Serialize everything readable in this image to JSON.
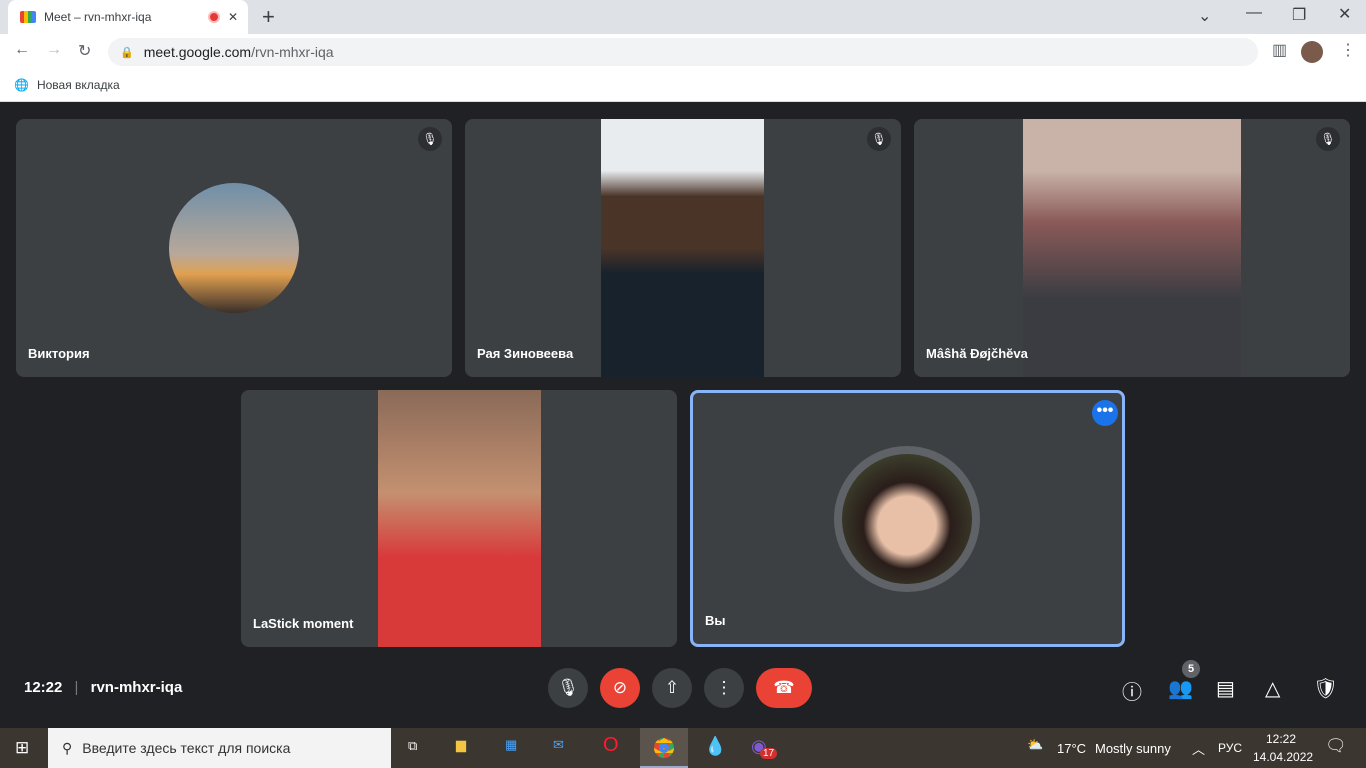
{
  "browser": {
    "tab_title": "Meet – rvn-mhxr-iqa",
    "url_host": "meet.google.com",
    "url_path": "/rvn-mhxr-iqa",
    "bookmark": "Новая вкладка"
  },
  "participants": [
    {
      "name": "Виктория",
      "muted": true
    },
    {
      "name": "Рая Зиновеева",
      "muted": true
    },
    {
      "name": "Mâŝhă Ðøjčhĕva",
      "muted": true
    },
    {
      "name": "LaStick moment",
      "muted": false
    },
    {
      "name": "Вы",
      "muted": false
    }
  ],
  "meeting": {
    "time": "12:22",
    "code": "rvn-mhxr-iqa",
    "participant_count": "5"
  },
  "colors": {
    "end_call": "#ea4335",
    "active_border": "#8ab4f8",
    "bg": "#202124"
  },
  "taskbar": {
    "search_placeholder": "Введите здесь текст для поиска",
    "weather_temp": "17°C",
    "weather_text": "Mostly sunny",
    "lang": "РУС",
    "clock_time": "12:22",
    "clock_date": "14.04.2022",
    "viber_badge": "17"
  }
}
